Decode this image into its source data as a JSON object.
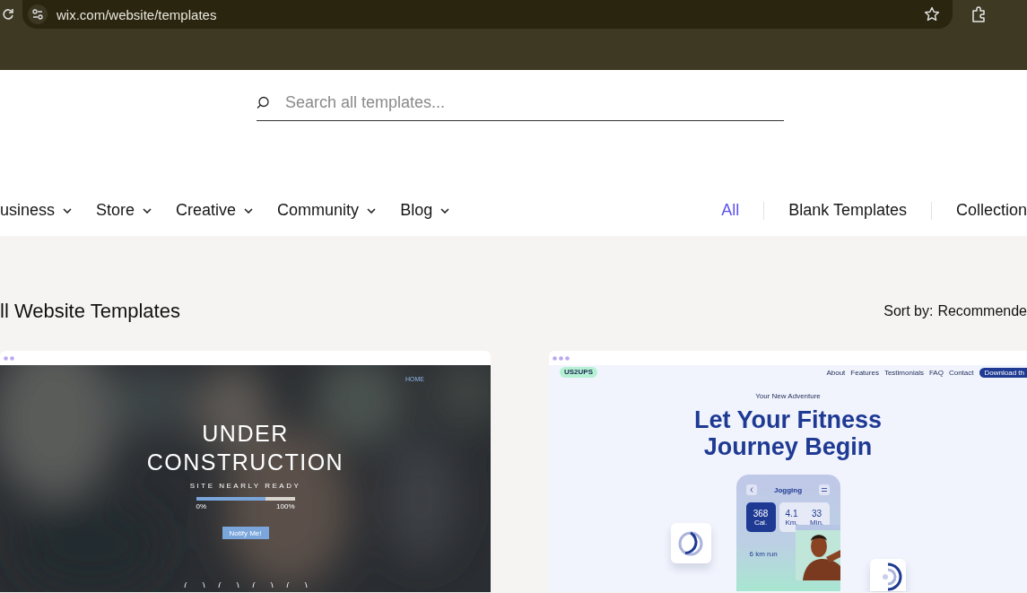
{
  "browser": {
    "url": "wix.com/website/templates"
  },
  "search": {
    "placeholder": "Search all templates..."
  },
  "categories": [
    {
      "label": "usiness"
    },
    {
      "label": "Store"
    },
    {
      "label": "Creative"
    },
    {
      "label": "Community"
    },
    {
      "label": "Blog"
    }
  ],
  "filters": [
    {
      "label": "All",
      "selected": true
    },
    {
      "label": "Blank Templates",
      "selected": false
    },
    {
      "label": "Collection",
      "selected": false
    }
  ],
  "heading": "ll Website Templates",
  "sort": {
    "label": "Sort by:",
    "value": "Recommende"
  },
  "templates": [
    {
      "kind": "under-construction",
      "nav": [
        "HOME"
      ],
      "title_lines": [
        "UNDER",
        "CONSTRUCTION"
      ],
      "subtitle": "SITE NEARLY READY",
      "progress": {
        "level": 0.7,
        "start": "0%",
        "end": "100%"
      },
      "button": "Notify Me!"
    },
    {
      "kind": "fitness",
      "logo": "US2UPS",
      "nav": [
        "About",
        "Features",
        "Testimonials",
        "FAQ",
        "Contact"
      ],
      "button": "Download th",
      "eyebrow": "Your New Adventure",
      "title_lines": [
        "Let Your Fitness",
        "Journey Begin"
      ],
      "app": {
        "title": "Jogging",
        "stats": [
          {
            "value": "368",
            "unit": "Cal.",
            "highlighted": true
          },
          {
            "value": "4.1",
            "unit": "Km.",
            "highlighted": false
          },
          {
            "value": "33",
            "unit": "Min.",
            "highlighted": false
          }
        ],
        "note": "6 km run"
      }
    }
  ]
}
